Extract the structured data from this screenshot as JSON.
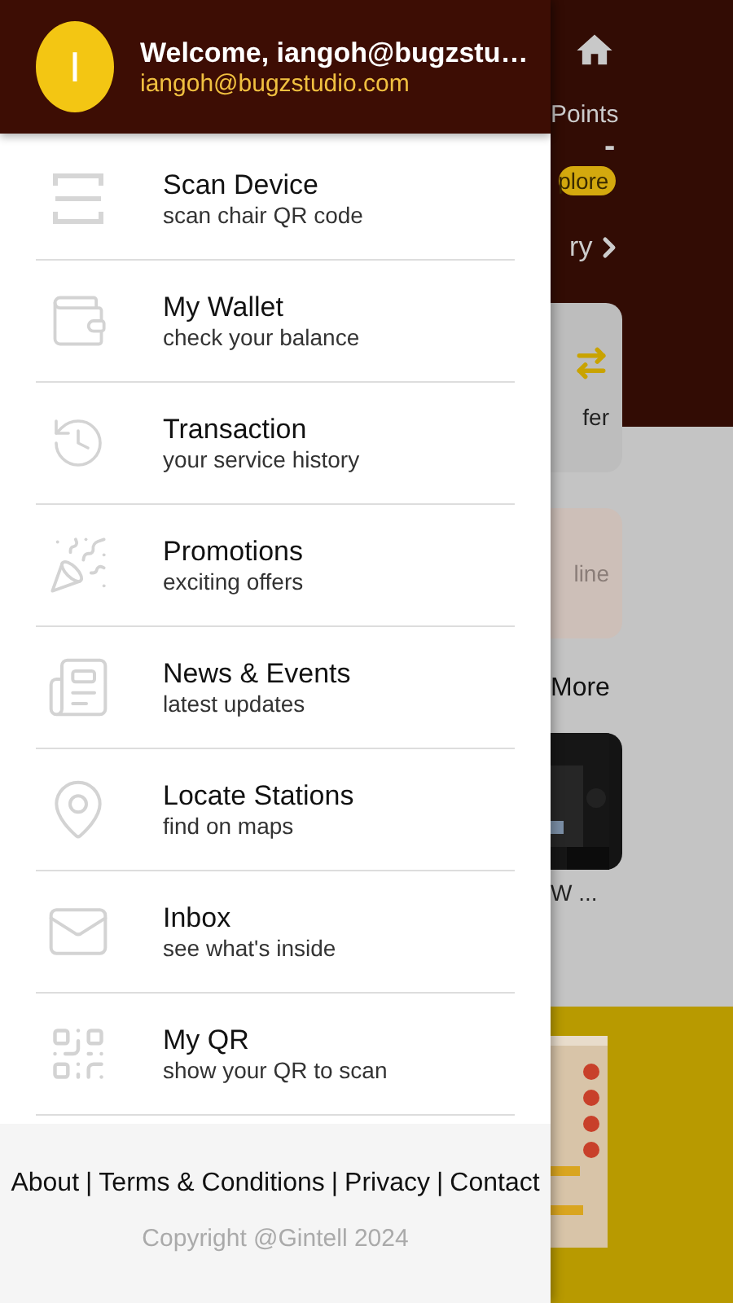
{
  "drawer": {
    "avatar_letter": "I",
    "title": "Welcome, iangoh@bugzstu…",
    "email": "iangoh@bugzstudio.com",
    "items": [
      {
        "kind": "scan",
        "title": "Scan Device",
        "subtitle": "scan chair QR code"
      },
      {
        "kind": "wallet",
        "title": "My Wallet",
        "subtitle": "check your balance"
      },
      {
        "kind": "history",
        "title": "Transaction",
        "subtitle": "your service history"
      },
      {
        "kind": "party",
        "title": "Promotions",
        "subtitle": "exciting offers"
      },
      {
        "kind": "news",
        "title": "News & Events",
        "subtitle": "latest updates"
      },
      {
        "kind": "pin",
        "title": "Locate Stations",
        "subtitle": "find on maps"
      },
      {
        "kind": "mail",
        "title": "Inbox",
        "subtitle": "see what's inside"
      },
      {
        "kind": "qr",
        "title": "My QR",
        "subtitle": "show your QR to scan"
      }
    ],
    "footer_links": [
      "About",
      "Terms & Conditions",
      "Privacy",
      "Contact"
    ],
    "footer_separator": "|",
    "copyright": "Copyright @Gintell 2024"
  },
  "home": {
    "points_label": "Points",
    "points_value": "-",
    "explore_badge": "plore",
    "history_link": "ry",
    "transfer_label": "fer",
    "online_label": "line",
    "more_label": "More",
    "news_caption": "W ..."
  }
}
